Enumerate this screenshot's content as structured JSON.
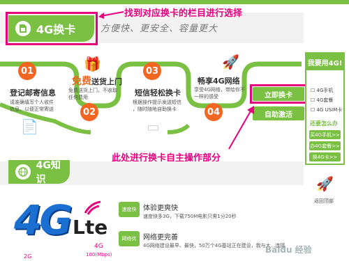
{
  "annotations": {
    "top": "找到对应换卡的栏目进行选择",
    "bottom": "此处进行换卡自主操作部分"
  },
  "section1": {
    "title": "4G换卡",
    "slogan": "方便快、更安全、容量更大"
  },
  "steps": [
    {
      "num": "01",
      "title": "登记邮寄信息",
      "desc": [
        "请准确填写个人收件",
        "信息，以便正常寄送"
      ]
    },
    {
      "num": "02",
      "title_prefix": "免费",
      "title_suffix": "送货上门",
      "desc": [
        "免费送货上门，不收取",
        "任何费用"
      ]
    },
    {
      "num": "03",
      "title": "短信轻松换卡",
      "desc": [
        "根据操作提示发送短信",
        "，随时随地自助换卡"
      ]
    },
    {
      "num": "04",
      "title": "畅享4G网络",
      "desc": [
        "享受4G网络，带给你不",
        "一样的感受"
      ]
    }
  ],
  "actions": {
    "change_now": "立即换卡",
    "self_activate": "自助激活"
  },
  "sidebar": {
    "title": "我要用4G!",
    "options": [
      "4G手机",
      "4G套餐",
      "4G USIM卡"
    ],
    "subtitle": "还要怎么办",
    "buttons": [
      "买4G手机>>",
      "办4G套餐>>",
      "换4G卡>>"
    ],
    "back_top": "返回顶部"
  },
  "section2": {
    "title": "4G知识"
  },
  "logo": {
    "main": "4G",
    "sub": "Lte",
    "small": "4G",
    "speed": "100(Mbps)",
    "gen": "2G"
  },
  "features": [
    {
      "badge": "速度快",
      "title": "体验更爽快",
      "desc": "速度快多3G，下载750M电影只需1分20秒"
    },
    {
      "badge": "网络优",
      "title": "网络更完善",
      "desc": "4G网络建设最早、最快，50万个4G基站正在建设，我与大...连接"
    }
  ],
  "watermark": "Baidu 经验",
  "colors": {
    "green": "#7ac043",
    "orange": "#f26622",
    "magenta": "#e6007e"
  }
}
